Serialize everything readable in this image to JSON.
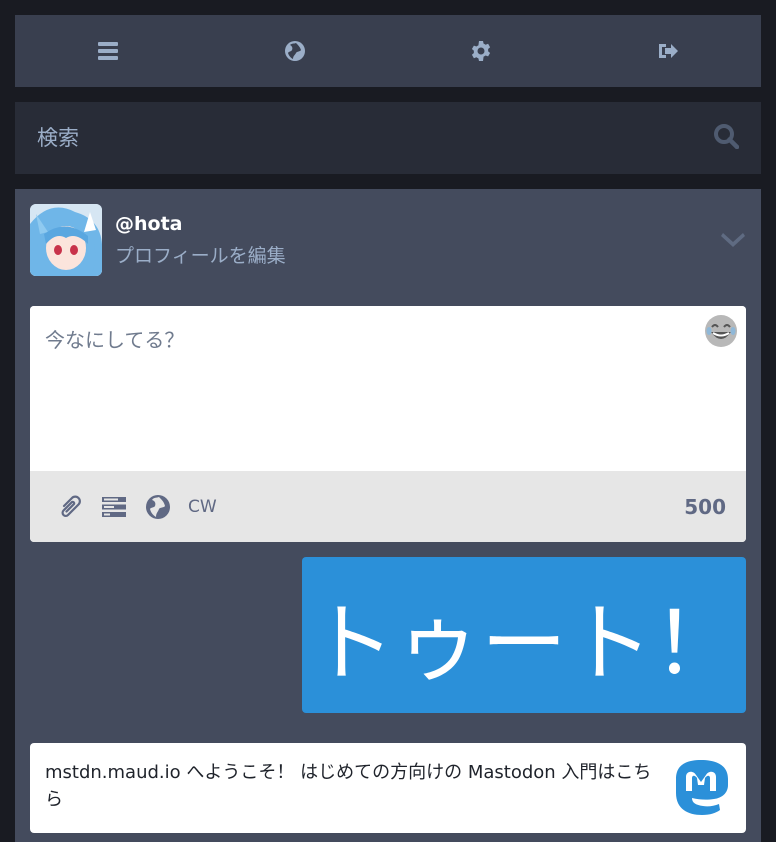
{
  "nav": {
    "items": [
      {
        "icon": "bars-icon",
        "label": ""
      },
      {
        "icon": "globe-icon",
        "label": ""
      },
      {
        "icon": "gear-icon",
        "label": ""
      },
      {
        "icon": "sign-out-icon",
        "label": ""
      }
    ]
  },
  "search": {
    "placeholder": "検索",
    "icon": "search-icon"
  },
  "account": {
    "handle": "@hota",
    "edit_profile": "プロフィールを編集"
  },
  "compose": {
    "placeholder": "今なにしてる？",
    "value": "",
    "tools": [
      "paperclip-icon",
      "poll-icon",
      "globe-icon"
    ],
    "cw_label": "CW",
    "char_count": "500"
  },
  "toot_button": {
    "label": "トゥート！"
  },
  "welcome": {
    "text": "mstdn.maud.io へようこそ！ はじめての方向けの Mastodon 入門はこちら"
  },
  "colors": {
    "background": "#191b22",
    "nav": "#393f4f",
    "search": "#282c37",
    "panel": "#444b5d",
    "accent": "#2b90d9",
    "muted_text": "#9baec8"
  }
}
